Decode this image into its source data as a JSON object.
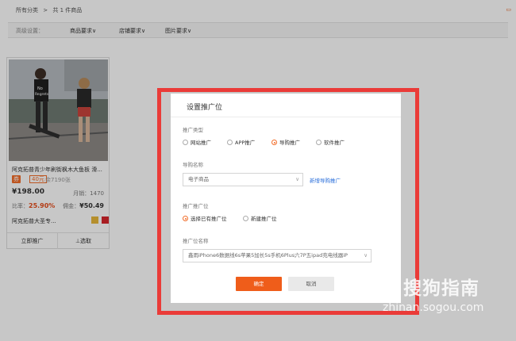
{
  "breadcrumb": {
    "root": "所有分类",
    "sep": ">",
    "count": "共 1 件商品"
  },
  "corner": {
    "icon": "folder-icon",
    "glyph": "▭"
  },
  "filters": {
    "label": "高级设置：",
    "items": [
      "商品要求∨",
      "店铺要求∨",
      "图片要求∨"
    ]
  },
  "product": {
    "title": "阿克拓普青少年刷街枫木大鱼板 滑...",
    "tag": "券",
    "coupon": "40元",
    "shop_count": "余7190张",
    "price": "¥198.00",
    "sales": "月销：1470",
    "ratio_label": "比率：",
    "ratio": "25.90%",
    "commission_label": "佣金：",
    "commission": "¥50.49",
    "shop": "阿克拓普大圣专...",
    "btn_promote": "立即推广",
    "btn_select": "⊥选取",
    "photo_text_1": "No",
    "photo_text_2": "Regrets"
  },
  "modal": {
    "title": "设置推广位",
    "type_label": "推广类型",
    "types": [
      "网站推广",
      "APP推广",
      "导购推广",
      "软件推广"
    ],
    "type_selected": 2,
    "guide_label": "导购名称",
    "guide_value": "电子商品",
    "guide_chevron": "∨",
    "new_guide_link": "新增导购推广",
    "pos_label": "推广推广位",
    "pos_options": [
      "选择已有推广位",
      "新建推广位"
    ],
    "pos_selected": 0,
    "pos_name_label": "推广位名称",
    "pos_name_value": "鑫雨iPhone6数据线6s苹果5加长5s手机6Plus六7P五ipad充电线器iP",
    "ok": "确定",
    "cancel": "取消"
  },
  "watermark": {
    "logo": "S",
    "name": "搜狗指南",
    "url": "zhinan.sogou.com"
  },
  "colors": {
    "accent": "#ef5d1a",
    "highlight": "#ea3b38",
    "link": "#2a6fdb"
  }
}
